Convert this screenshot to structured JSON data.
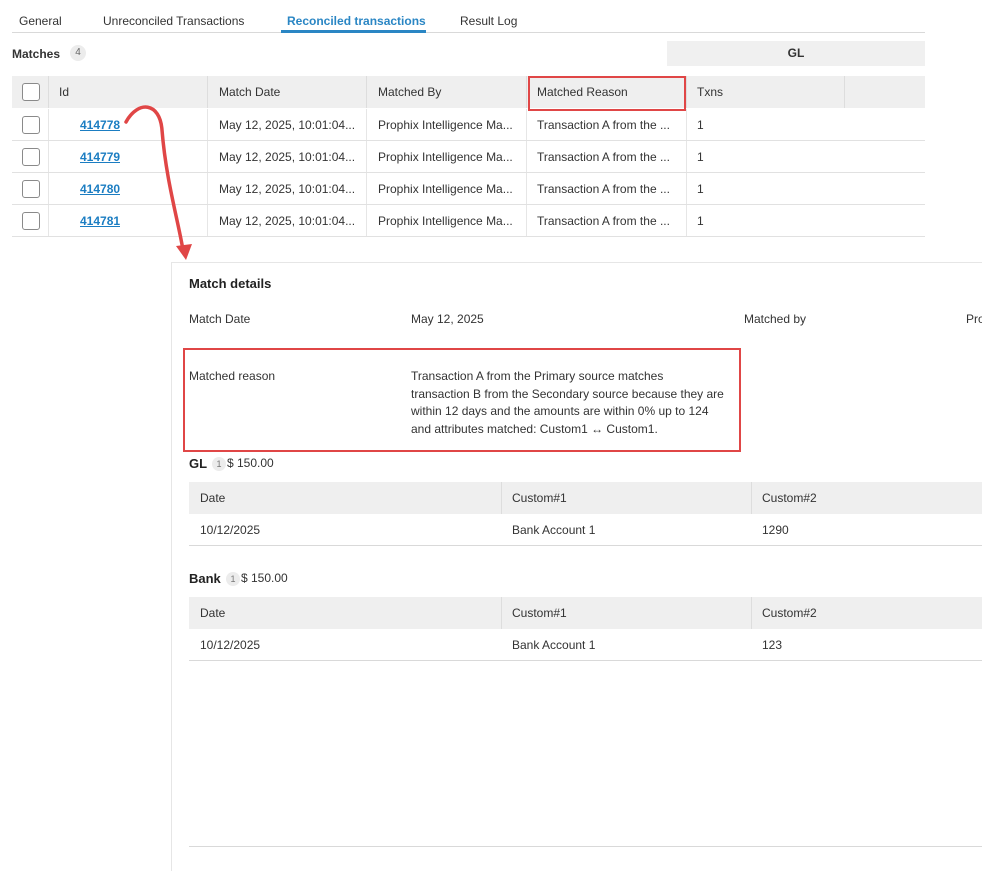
{
  "tabs": [
    {
      "label": "General",
      "active": false
    },
    {
      "label": "Unreconciled Transactions",
      "active": false
    },
    {
      "label": "Reconciled transactions",
      "active": true
    },
    {
      "label": "Result Log",
      "active": false
    }
  ],
  "matches": {
    "label": "Matches",
    "count": "4",
    "group_header": "GL",
    "columns": [
      "Id",
      "Match Date",
      "Matched By",
      "Matched Reason",
      "Txns"
    ],
    "rows": [
      {
        "id": "414778",
        "match_date": "May 12, 2025, 10:01:04...",
        "matched_by": "Prophix Intelligence Ma...",
        "matched_reason": "Transaction A from the ...",
        "txns": "1"
      },
      {
        "id": "414779",
        "match_date": "May 12, 2025, 10:01:04...",
        "matched_by": "Prophix Intelligence Ma...",
        "matched_reason": "Transaction A from the ...",
        "txns": "1"
      },
      {
        "id": "414780",
        "match_date": "May 12, 2025, 10:01:04...",
        "matched_by": "Prophix Intelligence Ma...",
        "matched_reason": "Transaction A from the ...",
        "txns": "1"
      },
      {
        "id": "414781",
        "match_date": "May 12, 2025, 10:01:04...",
        "matched_by": "Prophix Intelligence Ma...",
        "matched_reason": "Transaction A from the ...",
        "txns": "1"
      }
    ]
  },
  "details": {
    "title": "Match details",
    "match_date_label": "Match Date",
    "match_date_value": "May 12, 2025",
    "matched_by_label": "Matched by",
    "matched_by_value_partial": "Pro",
    "matched_reason_label": "Matched reason",
    "matched_reason_lines": [
      "Transaction A from the Primary source matches",
      "transaction B from the Secondary source because they are",
      "within 12 days and the amounts are within 0% up to 124",
      "and attributes matched: Custom1 ↔ Custom1."
    ],
    "sections": [
      {
        "name": "GL",
        "count": "1",
        "amount": "$ 150.00",
        "columns": [
          "Date",
          "Custom#1",
          "Custom#2"
        ],
        "row": [
          "10/12/2025",
          "Bank Account 1",
          "1290"
        ]
      },
      {
        "name": "Bank",
        "count": "1",
        "amount": "$ 150.00",
        "columns": [
          "Date",
          "Custom#1",
          "Custom#2"
        ],
        "row": [
          "10/12/2025",
          "Bank Account 1",
          "123"
        ]
      }
    ]
  },
  "colors": {
    "accent": "#2a86c4",
    "link": "#1b7dc2",
    "highlight": "#e04646"
  }
}
